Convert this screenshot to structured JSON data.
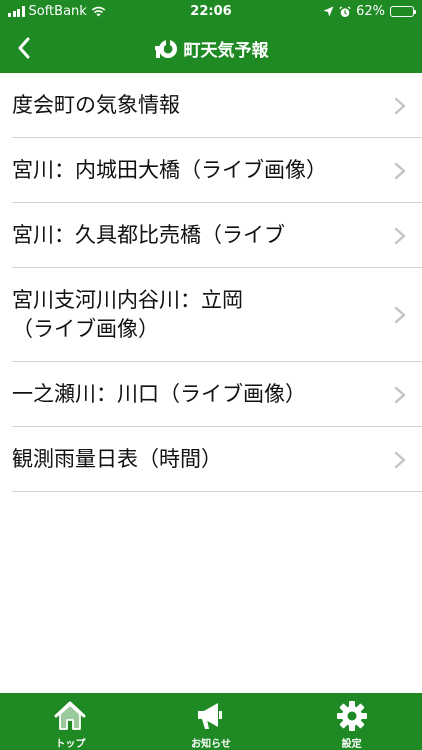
{
  "status_bar": {
    "carrier": "SoftBank",
    "time": "22:06",
    "battery_percent": "62%",
    "battery_level": 0.62
  },
  "nav": {
    "title": "町天気予報"
  },
  "list": {
    "items": [
      {
        "label": "度会町の気象情報"
      },
      {
        "label": "宮川：内城田大橋（ライブ画像）"
      },
      {
        "label": "宮川：久具都比売橋（ライブ"
      },
      {
        "label_line1": "宮川支河川内谷川：立岡",
        "label_line2": "（ライブ画像）"
      },
      {
        "label": "一之瀬川：川口（ライブ画像）"
      },
      {
        "label": "観測雨量日表（時間）"
      }
    ]
  },
  "tab_bar": {
    "items": [
      {
        "label": "トップ",
        "icon": "home-icon"
      },
      {
        "label": "お知らせ",
        "icon": "megaphone-icon"
      },
      {
        "label": "設定",
        "icon": "gear-icon"
      }
    ]
  },
  "colors": {
    "brand_green": "#1f8a24",
    "separator": "#d2d2d6",
    "chevron": "#c4c4c8"
  }
}
